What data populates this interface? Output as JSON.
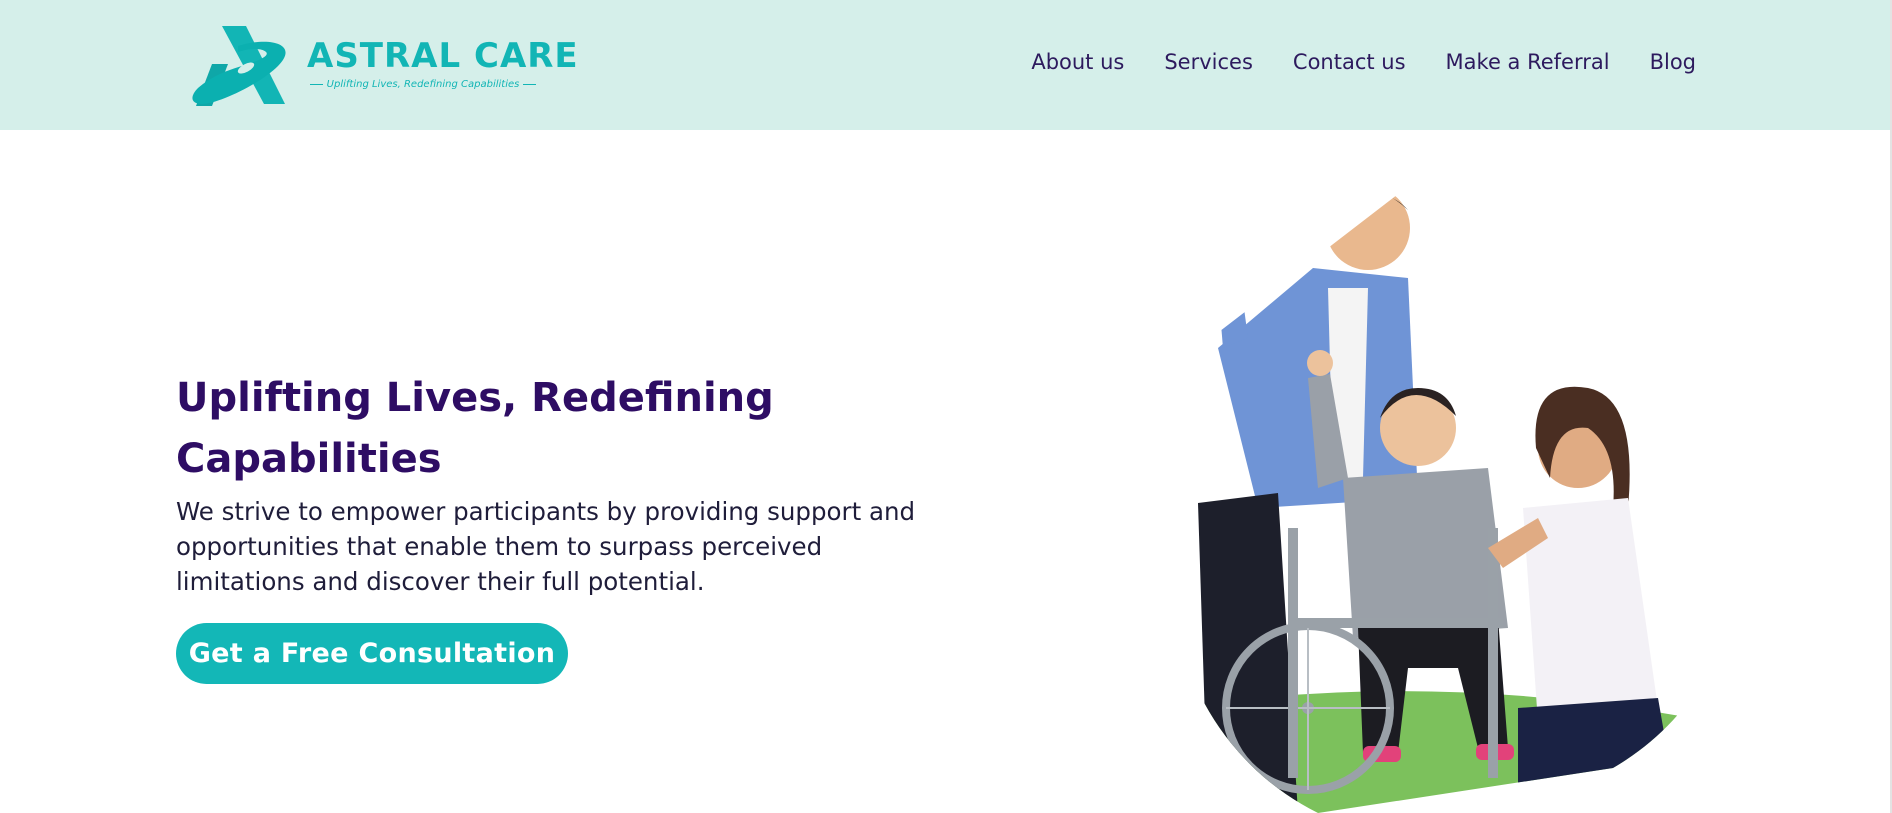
{
  "brand": {
    "name": "ASTRAL CARE",
    "tagline": "Uplifting Lives, Redefining Capabilities",
    "colors": {
      "teal": "#13b7b7",
      "navy": "#2e0d64",
      "header_bg": "#d5efea"
    }
  },
  "nav": {
    "items": [
      {
        "label": "About us"
      },
      {
        "label": "Services"
      },
      {
        "label": "Contact us"
      },
      {
        "label": "Make a Referral"
      },
      {
        "label": "Blog"
      }
    ]
  },
  "hero": {
    "title": "Uplifting Lives, Redefining Capabilities",
    "description": "We strive to empower participants by providing support and opportunities that enable them to surpass perceived limitations and discover their full potential.",
    "cta_label": "Get a Free Consultation",
    "image_icon": "caregivers-with-wheelchair-photo"
  }
}
